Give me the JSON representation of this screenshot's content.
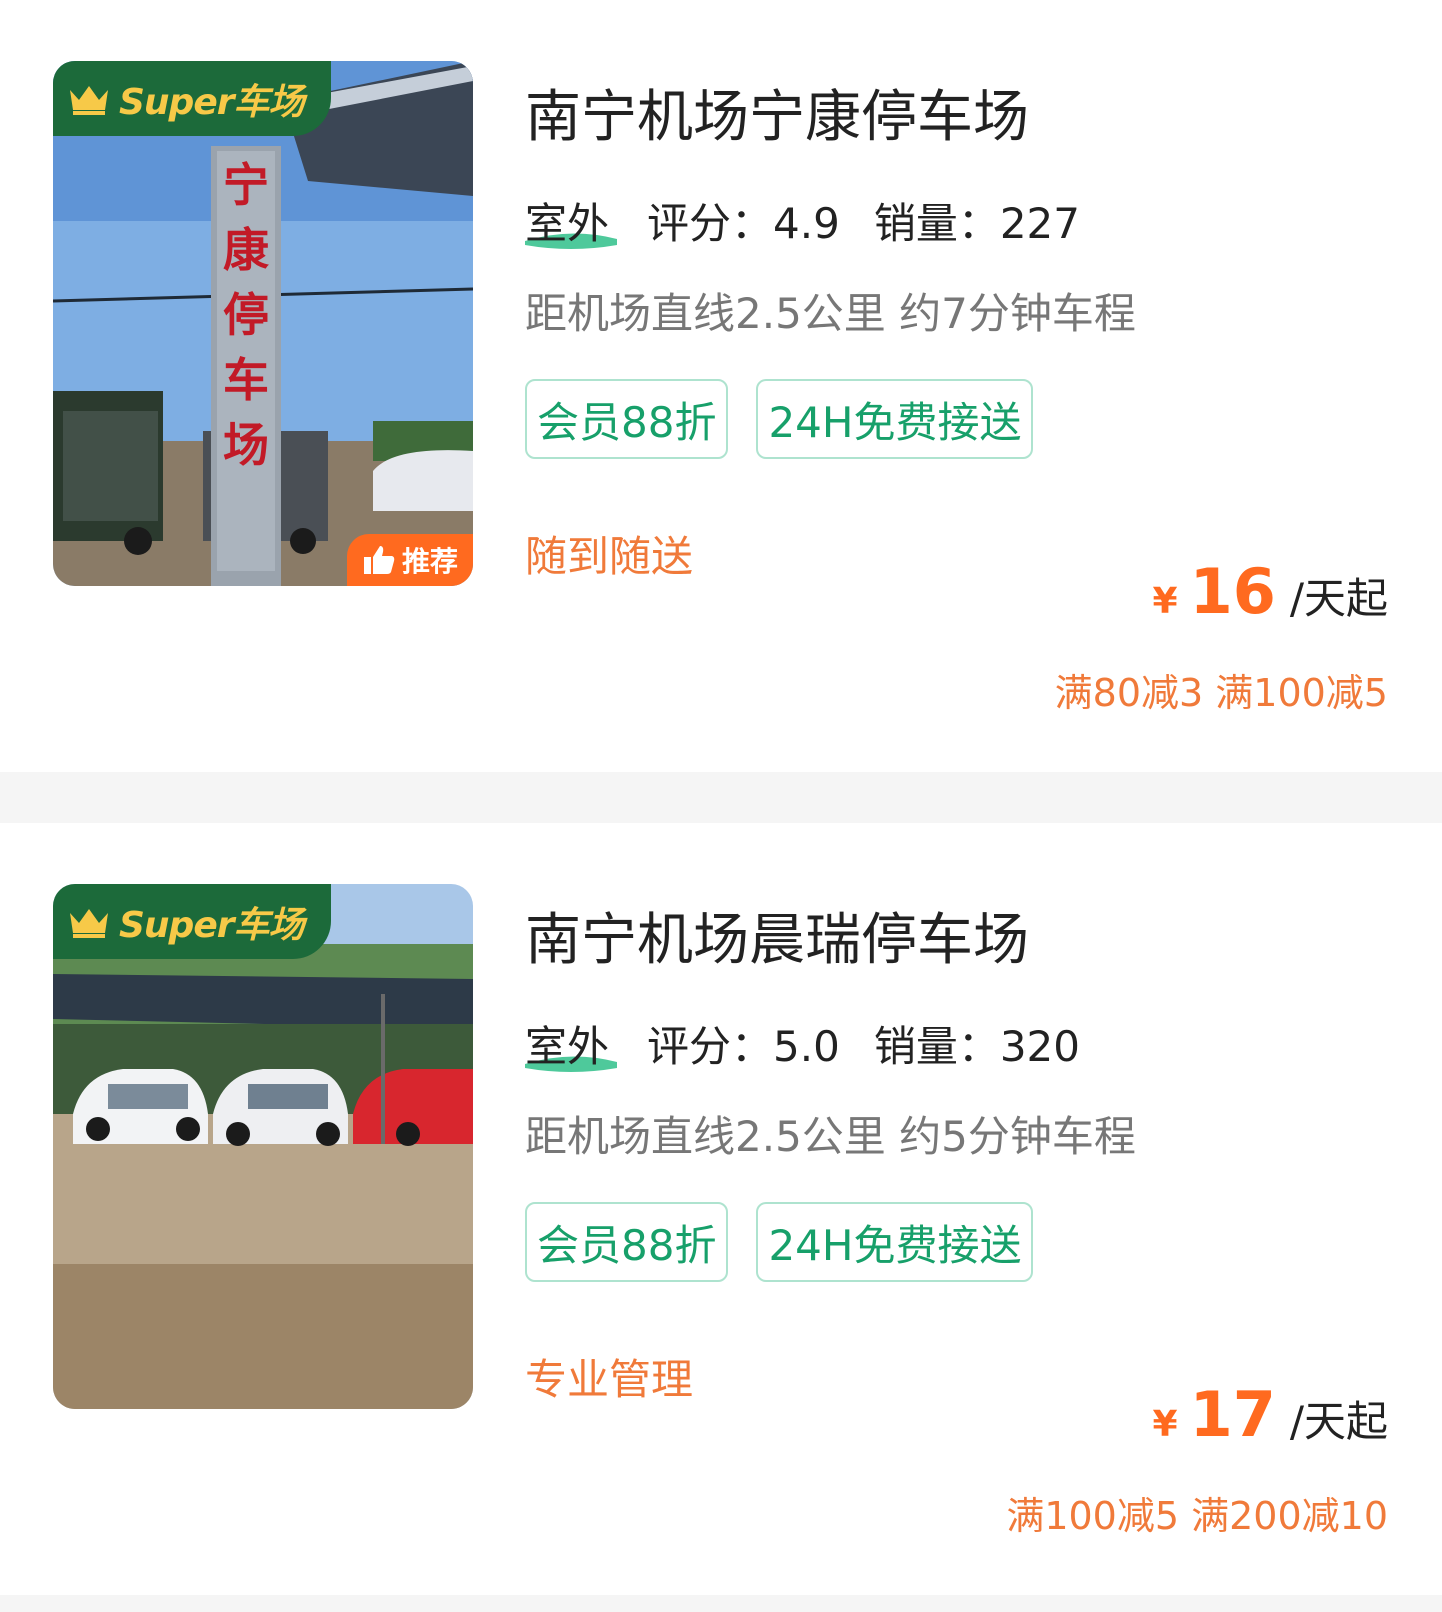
{
  "icons": {
    "crown": "crown-icon",
    "thumb": "thumbs-up-icon",
    "wave": "wave-underline-icon"
  },
  "colors": {
    "brand_green": "#1c6a3a",
    "badge_gold": "#f7c948",
    "tag_green": "#17a06a",
    "price_orange": "#ff6a1f"
  },
  "listings": [
    {
      "super_badge": "Super车场",
      "recommend_badge": "推荐",
      "title": "南宁机场宁康停车场",
      "environment": "室外",
      "rating": "评分：4.9",
      "sales": "销量：227",
      "distance": "距机场直线2.5公里 约7分钟车程",
      "tags": [
        "会员88折",
        "24H免费接送"
      ],
      "feature": "随到随送",
      "price": {
        "currency": "¥",
        "amount": "16",
        "unit": "/天起"
      },
      "discounts": "满80减3 满100减5"
    },
    {
      "super_badge": "Super车场",
      "title": "南宁机场晨瑞停车场",
      "environment": "室外",
      "rating": "评分：5.0",
      "sales": "销量：320",
      "distance": "距机场直线2.5公里 约5分钟车程",
      "tags": [
        "会员88折",
        "24H免费接送"
      ],
      "feature": "专业管理",
      "price": {
        "currency": "¥",
        "amount": "17",
        "unit": "/天起"
      },
      "discounts": "满100减5 满200减10"
    }
  ]
}
